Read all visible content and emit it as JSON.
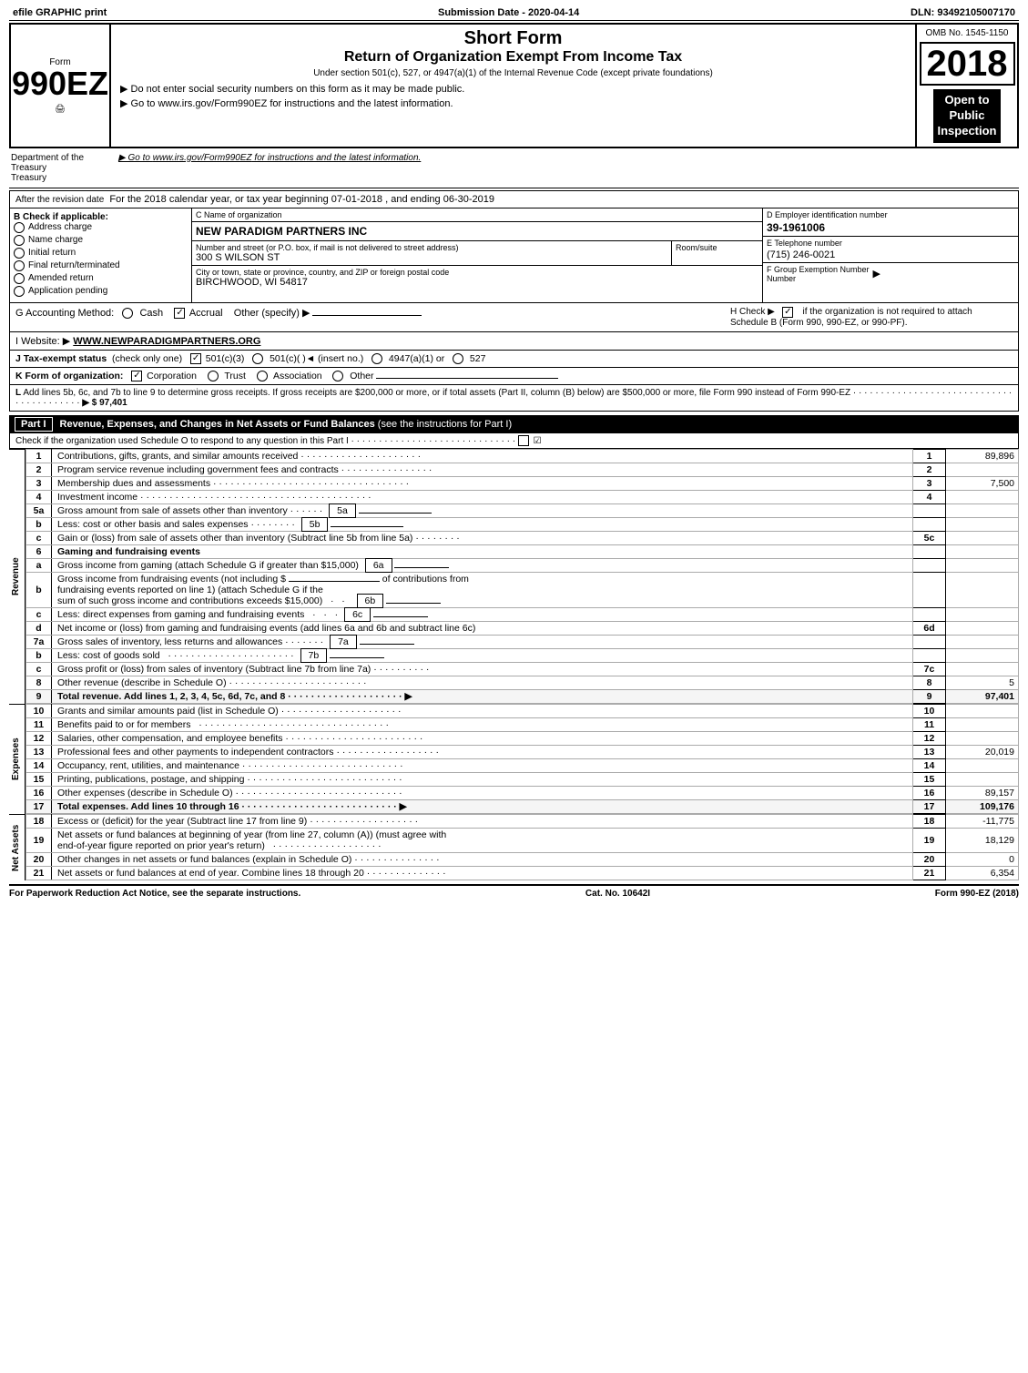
{
  "topbar": {
    "left": "efile GRAPHIC print",
    "middle": "Submission Date - 2020-04-14",
    "right": "DLN: 93492105007170"
  },
  "form": {
    "number": "990EZ",
    "number_label": "Form",
    "title_short": "Short Form",
    "title_return": "Return of Organization Exempt From Income Tax",
    "under_section": "Under section 501(c), 527, or 4947(a)(1) of the Internal Revenue Code (except private foundations)",
    "privacy_note": "▶ Do not enter social security numbers on this form as it may be made public.",
    "instructions_note": "▶ Go to www.irs.gov/Form990EZ for instructions and the latest information.",
    "year": "2018",
    "omb": "OMB No. 1545-1150",
    "open_public": "Open to\nPublic\nInspection"
  },
  "dept": {
    "label": "Department of the Treasury"
  },
  "tax_year": {
    "text": "For the 2018 calendar year, or tax year beginning 07-01-2018       , and ending 06-30-2019"
  },
  "check_service": {
    "label": "B Check if applicable:",
    "items": [
      "Address change",
      "Name change",
      "Initial return",
      "Final return/terminated",
      "Amended return",
      "Application pending"
    ]
  },
  "org": {
    "name_label": "C Name of organization",
    "name": "NEW PARADIGM PARTNERS INC",
    "address_label": "Number and street (or P.O. box, if mail is not delivered to street address)",
    "address": "300 S WILSON ST",
    "room_label": "Room/suite",
    "room": "",
    "city_label": "City or town, state or province, country, and ZIP or foreign postal code",
    "city": "BIRCHWOOD, WI  54817",
    "ein_label": "D Employer identification number",
    "ein": "39-1961006",
    "phone_label": "E Telephone number",
    "phone": "(715) 246-0021",
    "group_exempt_label": "F Group Exemption Number",
    "group_exempt": ""
  },
  "accounting": {
    "label": "G Accounting Method:",
    "cash_label": "Cash",
    "accrual_label": "Accrual",
    "accrual_checked": true,
    "other_label": "Other (specify) ▶",
    "h_label": "H Check ▶",
    "h_text": "if the organization is not required to attach Schedule B (Form 990, 990-EZ, or 990-PF).",
    "h_checked": true
  },
  "website": {
    "label": "I Website: ▶",
    "url": "WWW.NEWPARADIGMPARTNERS.ORG"
  },
  "tax_exempt": {
    "label": "J Tax-exempt status",
    "note": "(check only one)",
    "options": [
      "501(c)(3)",
      "501(c)(  )◄ (insert no.)",
      "4947(a)(1) or",
      "527"
    ],
    "checked": "501(c)(3)"
  },
  "form_org": {
    "label": "K Form of organization:",
    "options": [
      "Corporation",
      "Trust",
      "Association",
      "Other"
    ],
    "checked": "Corporation"
  },
  "l_row": {
    "text": "L Add lines 5b, 6c, and 7b to line 9 to determine gross receipts. If gross receipts are $200,000 or more, or if total assets (Part II, column (B) below) are $500,000 or more, file Form 990 instead of Form 990-EZ",
    "dots": "· · · · · · · · · · · · · · · · · · · · · · · · · · · · · · · · · · · · ·",
    "amount": "▶ $ 97,401"
  },
  "part1": {
    "label": "Part I",
    "title": "Revenue, Expenses, and Changes in Net Assets or Fund Balances",
    "note": "(see the instructions for Part I)",
    "check_note": "Check if the organization used Schedule O to respond to any question in this Part I",
    "check_dots": "· · · · · · · · · · · · · · · · · · · · · ·",
    "rows": [
      {
        "num": "1",
        "desc": "Contributions, gifts, grants, and similar amounts received · · · · · · · · · · · · · · · · · · · · ·",
        "line_col": "1",
        "amount": "89,896"
      },
      {
        "num": "2",
        "desc": "Program service revenue including government fees and contracts · · · · · · · · · · · · · · · ·",
        "line_col": "2",
        "amount": ""
      },
      {
        "num": "3",
        "desc": "Membership dues and assessments · · · · · · · · · · · · · · · · · · · · · · · · · · · · · · · · · ·",
        "line_col": "3",
        "amount": "7,500"
      },
      {
        "num": "4",
        "desc": "Investment income · · · · · · · · · · · · · · · · · · · · · · · · · · · · · · · · · · · · · · · ·",
        "line_col": "4",
        "amount": ""
      },
      {
        "num": "5a",
        "desc": "Gross amount from sale of assets other than inventory · · · · · ·",
        "sub_col": "5a",
        "line_col": "",
        "amount": ""
      },
      {
        "num": "b",
        "desc": "Less: cost or other basis and sales expenses · · · · · · · ·",
        "sub_col": "5b",
        "line_col": "",
        "amount": ""
      },
      {
        "num": "c",
        "desc": "Gain or (loss) from sale of assets other than inventory (Subtract line 5b from line 5a) · · · · · · · ·",
        "line_col": "5c",
        "amount": ""
      },
      {
        "num": "6",
        "desc": "Gaming and fundraising events",
        "line_col": "",
        "amount": ""
      },
      {
        "num": "a",
        "desc": "Gross income from gaming (attach Schedule G if greater than $15,000)",
        "sub_col": "6a",
        "line_col": "",
        "amount": ""
      },
      {
        "num": "b",
        "desc": "Gross income from fundraising events (not including $ _____________ of contributions from fundraising events reported on line 1) (attach Schedule G if the sum of such gross income and contributions exceeds $15,000)",
        "sub_col": "6b",
        "line_col": "",
        "amount": ""
      },
      {
        "num": "c",
        "desc": "Less: direct expenses from gaming and fundraising events",
        "sub_col": "6c",
        "line_col": "",
        "amount": ""
      },
      {
        "num": "d",
        "desc": "Net income or (loss) from gaming and fundraising events (add lines 6a and 6b and subtract line 6c)",
        "line_col": "6d",
        "amount": ""
      },
      {
        "num": "7a",
        "desc": "Gross sales of inventory, less returns and allowances · · · · · · ·",
        "sub_col": "7a",
        "line_col": "",
        "amount": ""
      },
      {
        "num": "b",
        "desc": "Less: cost of goods sold · · · · · · · · · · · · · · · · · · · · · ·",
        "sub_col": "7b",
        "line_col": "",
        "amount": ""
      },
      {
        "num": "c",
        "desc": "Gross profit or (loss) from sales of inventory (Subtract line 7b from line 7a) · · · · · · · · · ·",
        "line_col": "7c",
        "amount": ""
      },
      {
        "num": "8",
        "desc": "Other revenue (describe in Schedule O) · · · · · · · · · · · · · · · · · · · · · · · ·",
        "line_col": "8",
        "amount": "5"
      },
      {
        "num": "9",
        "desc": "Total revenue. Add lines 1, 2, 3, 4, 5c, 6d, 7c, and 8 · · · · · · · · · · · · · · · · · · · · ▶",
        "line_col": "9",
        "amount": "97,401",
        "bold": true
      },
      {
        "num": "10",
        "desc": "Grants and similar amounts paid (list in Schedule O) · · · · · · · · · · · · · · · · · · · · ·",
        "line_col": "10",
        "amount": ""
      },
      {
        "num": "11",
        "desc": "Benefits paid to or for members · · · · · · · · · · · · · · · · · · · · · · · · · · · · · · · · ·",
        "line_col": "11",
        "amount": ""
      },
      {
        "num": "12",
        "desc": "Salaries, other compensation, and employee benefits · · · · · · · · · · · · · · · · · · · · · · · ·",
        "line_col": "12",
        "amount": ""
      },
      {
        "num": "13",
        "desc": "Professional fees and other payments to independent contractors · · · · · · · · · · · · · · · · · ·",
        "line_col": "13",
        "amount": "20,019"
      },
      {
        "num": "14",
        "desc": "Occupancy, rent, utilities, and maintenance · · · · · · · · · · · · · · · · · · · · · · · · · · · ·",
        "line_col": "14",
        "amount": ""
      },
      {
        "num": "15",
        "desc": "Printing, publications, postage, and shipping · · · · · · · · · · · · · · · · · · · · · · · · · · ·",
        "line_col": "15",
        "amount": ""
      },
      {
        "num": "16",
        "desc": "Other expenses (describe in Schedule O) · · · · · · · · · · · · · · · · · · · · · · · · · · · · ·",
        "line_col": "16",
        "amount": "89,157"
      },
      {
        "num": "17",
        "desc": "Total expenses. Add lines 10 through 16 · · · · · · · · · · · · · · · · · · · · · · · · · · · ▶",
        "line_col": "17",
        "amount": "109,176",
        "bold": true
      },
      {
        "num": "18",
        "desc": "Excess or (deficit) for the year (Subtract line 17 from line 9) · · · · · · · · · · · · · · · · · · ·",
        "line_col": "18",
        "amount": "-11,775"
      },
      {
        "num": "19",
        "desc": "Net assets or fund balances at beginning of year (from line 27, column (A)) (must agree with end-of-year figure reported on prior year's return) · · · · · · · · · · · · · · · · · · ·",
        "line_col": "19",
        "amount": "18,129"
      },
      {
        "num": "20",
        "desc": "Other changes in net assets or fund balances (explain in Schedule O) · · · · · · · · · · · · · · ·",
        "line_col": "20",
        "amount": "0"
      },
      {
        "num": "21",
        "desc": "Net assets or fund balances at end of year. Combine lines 18 through 20 · · · · · · · · · · · · · ·",
        "line_col": "21",
        "amount": "6,354"
      }
    ]
  },
  "footer": {
    "left": "For Paperwork Reduction Act Notice, see the separate instructions.",
    "cat": "Cat. No. 10642I",
    "right": "Form 990-EZ (2018)"
  },
  "side_labels": {
    "revenue": "Revenue",
    "expenses": "Expenses",
    "net_assets": "Net Assets"
  }
}
